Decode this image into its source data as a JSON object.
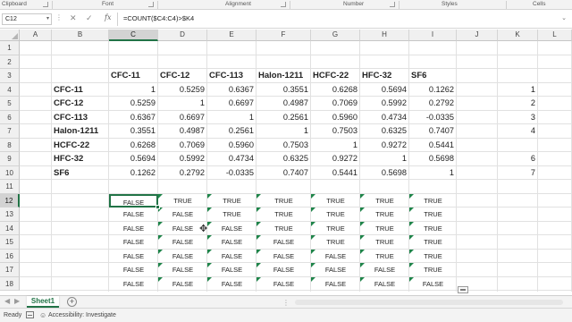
{
  "ribbon": {
    "groups": [
      "Clipboard",
      "Font",
      "Alignment",
      "Number",
      "Styles",
      "Cells"
    ]
  },
  "formula_bar": {
    "name_box": "C12",
    "dropdown_icon": "chevron-down-icon",
    "more_icon": "vertical-dots-icon",
    "cancel_icon": "x-icon",
    "enter_icon": "check-icon",
    "fx_label": "fx",
    "formula": "=COUNT($C4:C4)>$K4",
    "expand_icon": "chevron-down-icon"
  },
  "grid": {
    "columns": [
      "A",
      "B",
      "C",
      "D",
      "E",
      "F",
      "G",
      "H",
      "I",
      "J",
      "K",
      "L"
    ],
    "selected_column": "C",
    "rows": [
      "1",
      "2",
      "3",
      "4",
      "5",
      "6",
      "7",
      "8",
      "9",
      "10",
      "11",
      "12",
      "13",
      "14",
      "15",
      "16",
      "17",
      "18"
    ],
    "selected_row": "12",
    "active_cell": "C12"
  },
  "matrix": {
    "headers": [
      "CFC-11",
      "CFC-12",
      "CFC-113",
      "Halon-1211",
      "HCFC-22",
      "HFC-32",
      "SF6"
    ],
    "row_labels": [
      "CFC-11",
      "CFC-12",
      "CFC-113",
      "Halon-1211",
      "HCFC-22",
      "HFC-32",
      "SF6"
    ],
    "values": [
      [
        "1",
        "0.5259",
        "0.6367",
        "0.3551",
        "0.6268",
        "0.5694",
        "0.1262"
      ],
      [
        "0.5259",
        "1",
        "0.6697",
        "0.4987",
        "0.7069",
        "0.5992",
        "0.2792"
      ],
      [
        "0.6367",
        "0.6697",
        "1",
        "0.2561",
        "0.5960",
        "0.4734",
        "-0.0335"
      ],
      [
        "0.3551",
        "0.4987",
        "0.2561",
        "1",
        "0.7503",
        "0.6325",
        "0.7407"
      ],
      [
        "0.6268",
        "0.7069",
        "0.5960",
        "0.7503",
        "1",
        "0.9272",
        "0.5441"
      ],
      [
        "0.5694",
        "0.5992",
        "0.4734",
        "0.6325",
        "0.9272",
        "1",
        "0.5698"
      ],
      [
        "0.1262",
        "0.2792",
        "-0.0335",
        "0.7407",
        "0.5441",
        "0.5698",
        "1"
      ]
    ],
    "k_values": [
      "1",
      "2",
      "3",
      "4",
      "6",
      "7"
    ]
  },
  "booleans": [
    [
      "FALSE",
      "TRUE",
      "TRUE",
      "TRUE",
      "TRUE",
      "TRUE",
      "TRUE"
    ],
    [
      "FALSE",
      "FALSE",
      "TRUE",
      "TRUE",
      "TRUE",
      "TRUE",
      "TRUE"
    ],
    [
      "FALSE",
      "FALSE",
      "FALSE",
      "TRUE",
      "TRUE",
      "TRUE",
      "TRUE"
    ],
    [
      "FALSE",
      "FALSE",
      "FALSE",
      "FALSE",
      "TRUE",
      "TRUE",
      "TRUE"
    ],
    [
      "FALSE",
      "FALSE",
      "FALSE",
      "FALSE",
      "FALSE",
      "TRUE",
      "TRUE"
    ],
    [
      "FALSE",
      "FALSE",
      "FALSE",
      "FALSE",
      "FALSE",
      "FALSE",
      "TRUE"
    ],
    [
      "FALSE",
      "FALSE",
      "FALSE",
      "FALSE",
      "FALSE",
      "FALSE",
      "FALSE"
    ]
  ],
  "sheet_tabs": {
    "prev_icon": "chevron-left-icon",
    "next_icon": "chevron-right-icon",
    "active": "Sheet1",
    "add_icon": "+"
  },
  "status_bar": {
    "ready": "Ready",
    "accessibility": "Accessibility: Investigate"
  },
  "colors": {
    "accent": "#217346",
    "error_indicator": "#1e8449"
  }
}
